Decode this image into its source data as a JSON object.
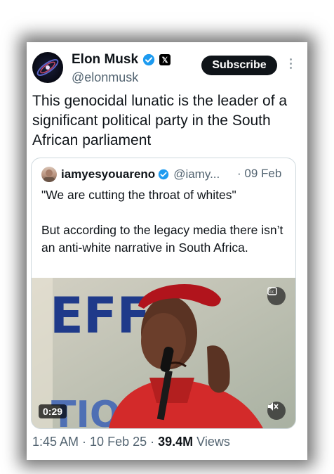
{
  "author": {
    "name": "Elon Musk",
    "handle": "@elonmusk",
    "avatar_icon": "galaxy-avatar",
    "verified_color": "#1d9bf0",
    "affiliate_badge": "𝕏"
  },
  "subscribe_label": "Subscribe",
  "tweet_text": "This genocidal lunatic is the leader of a significant political party in the South African parliament",
  "quote": {
    "name": "iamyesyouareno",
    "handle": "@iamy...",
    "date": "· 09 Feb",
    "line1": "\"We are cutting the throat of whites\"",
    "line2": "But according to the legacy media there isn’t an anti-white narrative in South Africa.",
    "video": {
      "banner_text": "EFF",
      "lower_text": "TIO",
      "duration": "0:29",
      "cc_icon": "closed-captions-icon",
      "mute_icon": "muted-speaker-icon"
    }
  },
  "meta": {
    "time": "1:45 AM",
    "date": "10 Feb 25",
    "views_count": "39.4M",
    "views_label": "Views",
    "separator": " · "
  }
}
